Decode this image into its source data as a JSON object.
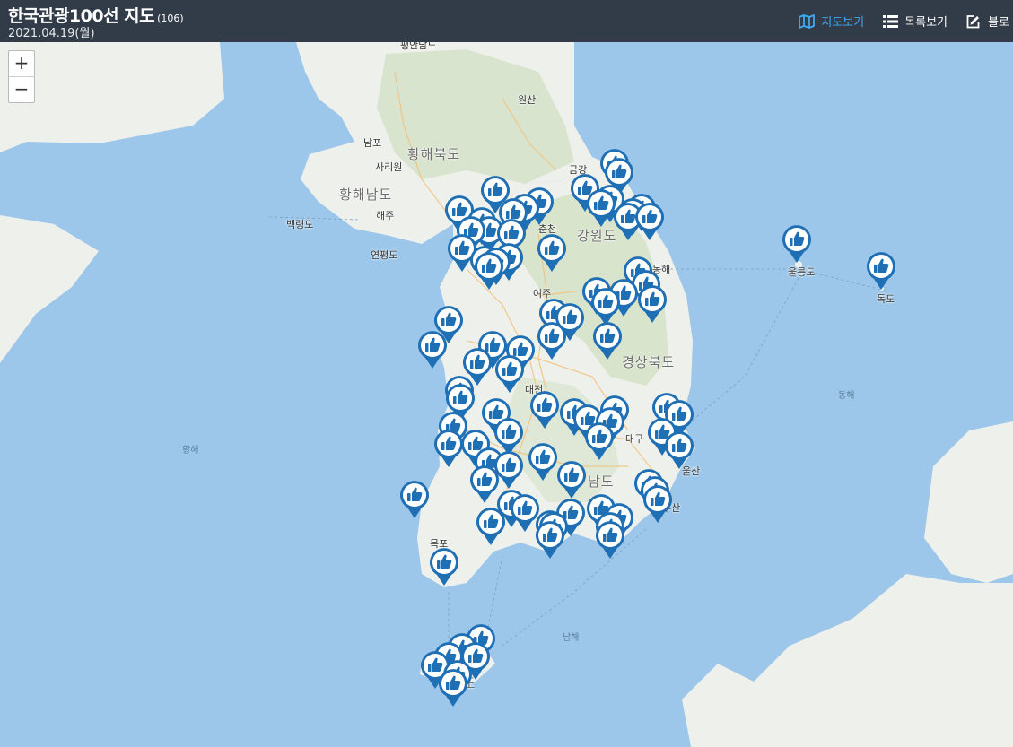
{
  "header": {
    "title": "한국관광100선 지도",
    "count": "(106)",
    "date": "2021.04.19(월)"
  },
  "nav": [
    {
      "label": "지도보기",
      "icon": "map-icon",
      "active": true
    },
    {
      "label": "목록보기",
      "icon": "list-icon",
      "active": false
    },
    {
      "label": "블로",
      "icon": "edit-icon",
      "active": false
    }
  ],
  "zoom": {
    "in_label": "+",
    "out_label": "−"
  },
  "colors": {
    "header_bg": "#323c48",
    "active_nav": "#3fa9f5",
    "pin": "#1f6fb5",
    "sea": "#9cc7ea",
    "land": "#eef0ec"
  },
  "labels": {
    "regions": [
      "황해북도",
      "황해남도",
      "강원도",
      "경상북도",
      "남도"
    ],
    "cities": [
      "평안남도",
      "원산",
      "남포",
      "사리원",
      "해주",
      "백령도",
      "연평도",
      "금강",
      "춘천",
      "강원",
      "동해",
      "울릉도",
      "독도",
      "여주",
      "인",
      "대전",
      "대구",
      "울산",
      "부산",
      "목포",
      "사",
      "제주",
      "도"
    ],
    "seas": [
      "동해",
      "황해",
      "남해"
    ]
  },
  "marker_icon": "thumbs-up-icon"
}
